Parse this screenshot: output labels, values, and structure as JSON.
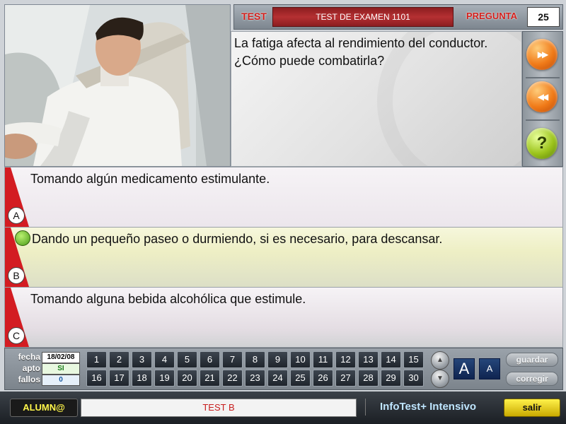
{
  "header": {
    "test_label": "TEST",
    "exam_title": "TEST DE EXAMEN 1101",
    "question_label": "PREGUNTA",
    "question_number": "25"
  },
  "question": {
    "text": "La fatiga afecta al rendimiento del conductor. ¿Cómo puede combatirla?"
  },
  "side_buttons": {
    "next_icon": "fast-forward-icon",
    "prev_icon": "rewind-icon",
    "help_icon": "help-icon",
    "help_glyph": "?",
    "next_glyph": "▶▶",
    "prev_glyph": "◀◀"
  },
  "answers": [
    {
      "letter": "A",
      "text": "Tomando algún medicamento estimulante."
    },
    {
      "letter": "B",
      "text": "Dando un pequeño paseo o durmiendo, si es necesario, para descansar."
    },
    {
      "letter": "C",
      "text": "Tomando alguna bebida alcohólica que estimule."
    }
  ],
  "info": {
    "date_label": "fecha",
    "date_value": "18/02/08",
    "apto_label": "apto",
    "apto_value": "SI",
    "fallos_label": "fallos",
    "fallos_value": "0"
  },
  "question_grid": {
    "row1": [
      "1",
      "2",
      "3",
      "4",
      "5",
      "6",
      "7",
      "8",
      "9",
      "10",
      "11",
      "12",
      "13",
      "14",
      "15"
    ],
    "row2": [
      "16",
      "17",
      "18",
      "19",
      "20",
      "21",
      "22",
      "23",
      "24",
      "25",
      "26",
      "27",
      "28",
      "29",
      "30"
    ]
  },
  "font_buttons": {
    "large": "A",
    "small": "A"
  },
  "actions": {
    "save": "guardar",
    "correct": "corregir"
  },
  "footer": {
    "alumn_label": "ALUMN@",
    "student_name": "TEST B",
    "brand": "InfoTest+ Intensivo",
    "exit": "salir"
  },
  "colors": {
    "accent_red": "#d4201c",
    "title_bar": "#b53032",
    "answer_correct_bg": "#eeefc5",
    "exit_button": "#fff14a"
  }
}
